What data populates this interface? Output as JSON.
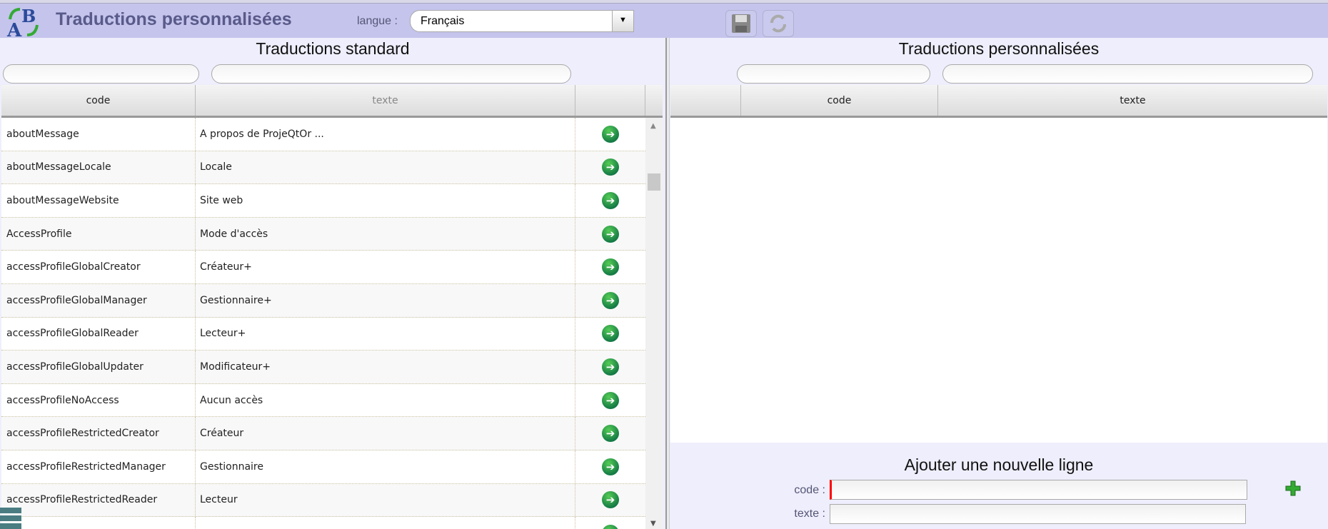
{
  "header": {
    "title": "Traductions personnalisées",
    "language_label": "langue :",
    "language_value": "Français"
  },
  "left_panel": {
    "title": "Traductions standard",
    "columns": [
      "code",
      "texte",
      ""
    ],
    "rows": [
      {
        "code": "aboutMessage",
        "texte": "A propos de ProjeQtOr ..."
      },
      {
        "code": "aboutMessageLocale",
        "texte": "Locale"
      },
      {
        "code": "aboutMessageWebsite",
        "texte": "Site web"
      },
      {
        "code": "AccessProfile",
        "texte": "Mode d'accès"
      },
      {
        "code": "accessProfileGlobalCreator",
        "texte": "Créateur+"
      },
      {
        "code": "accessProfileGlobalManager",
        "texte": "Gestionnaire+"
      },
      {
        "code": "accessProfileGlobalReader",
        "texte": "Lecteur+"
      },
      {
        "code": "accessProfileGlobalUpdater",
        "texte": "Modificateur+"
      },
      {
        "code": "accessProfileNoAccess",
        "texte": "Aucun accès"
      },
      {
        "code": "accessProfileRestrictedCreator",
        "texte": "Créateur"
      },
      {
        "code": "accessProfileRestrictedManager",
        "texte": "Gestionnaire"
      },
      {
        "code": "accessProfileRestrictedReader",
        "texte": "Lecteur"
      }
    ]
  },
  "right_panel": {
    "title": "Traductions personnalisées",
    "columns": [
      "",
      "code",
      "texte"
    ],
    "add_section": {
      "title": "Ajouter une nouvelle ligne",
      "code_label": "code :",
      "texte_label": "texte :",
      "code_value": "",
      "texte_value": ""
    }
  }
}
